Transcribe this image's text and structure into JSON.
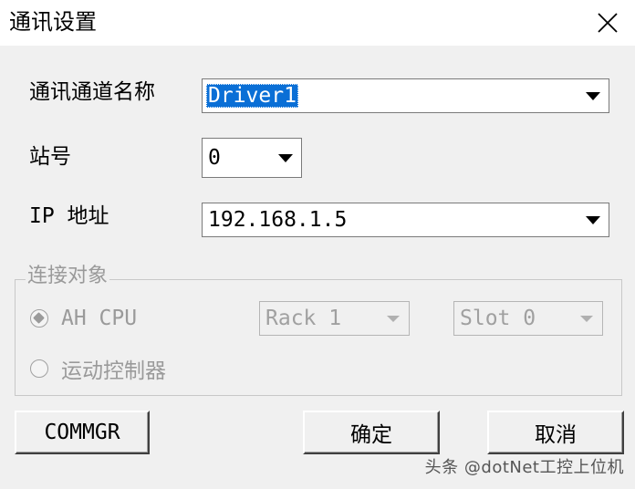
{
  "window": {
    "title": "通讯设置"
  },
  "form": {
    "channel_label": "通讯通道名称",
    "channel_value": "Driver1",
    "station_label": "站号",
    "station_value": "0",
    "ip_label": "IP 地址",
    "ip_value": "192.168.1.5"
  },
  "connection": {
    "group_label": "连接对象",
    "options": [
      {
        "label": "AH CPU",
        "checked": true
      },
      {
        "label": "运动控制器",
        "checked": false
      }
    ],
    "rack_value": "Rack 1",
    "slot_value": "Slot 0"
  },
  "buttons": {
    "commgr": "COMMGR",
    "ok": "确定",
    "cancel": "取消"
  },
  "watermark": "头条 @dotNet工控上位机",
  "colors": {
    "selection": "#0a6fd6",
    "window_bg": "#f0f0f0",
    "disabled_text": "#9a9a9a"
  }
}
